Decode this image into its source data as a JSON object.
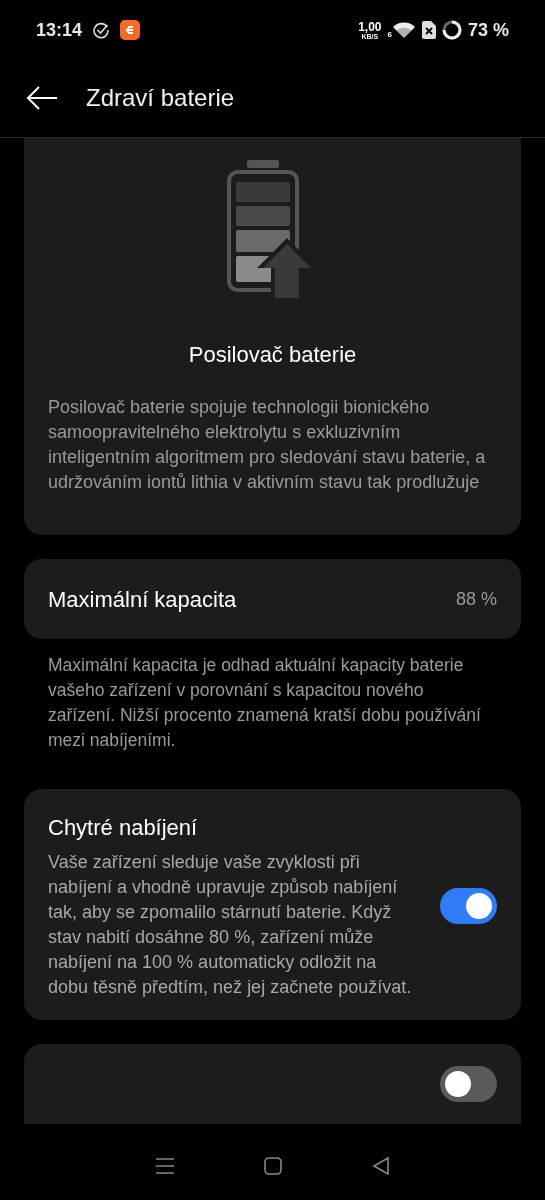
{
  "status_bar": {
    "time": "13:14",
    "net_speed": "1,00",
    "net_unit": "KB/S",
    "wifi_band": "6",
    "battery": "73 %"
  },
  "header": {
    "title": "Zdraví baterie"
  },
  "booster_card": {
    "title": "Posilovač baterie",
    "description": "Posilovač baterie spojuje technologii bionického samoopravitelného elektrolytu s exkluzivním inteligentním algoritmem pro sledování stavu baterie, a udržováním iontů lithia v aktivním stavu tak prodlužuje"
  },
  "capacity_card": {
    "label": "Maximální kapacita",
    "value": "88 %",
    "note": "Maximální kapacita je odhad aktuální kapacity baterie vašeho zařízení v porovnání s kapacitou nového zařízení. Nižší procento znamená kratší dobu používání mezi nabíjeními."
  },
  "smart_charging": {
    "title": "Chytré nabíjení",
    "description": "Vaše zařízení sleduje vaše zvyklosti při nabíjení a vhodně upravuje způsob nabíjení tak, aby se zpomalilo stárnutí baterie. Když stav nabití dosáhne 80 %, zařízení může nabíjení na 100 % automaticky odložit na dobu těsně předtím, než jej začnete používat.",
    "on": true
  },
  "charge_limit": {
    "on": false
  }
}
